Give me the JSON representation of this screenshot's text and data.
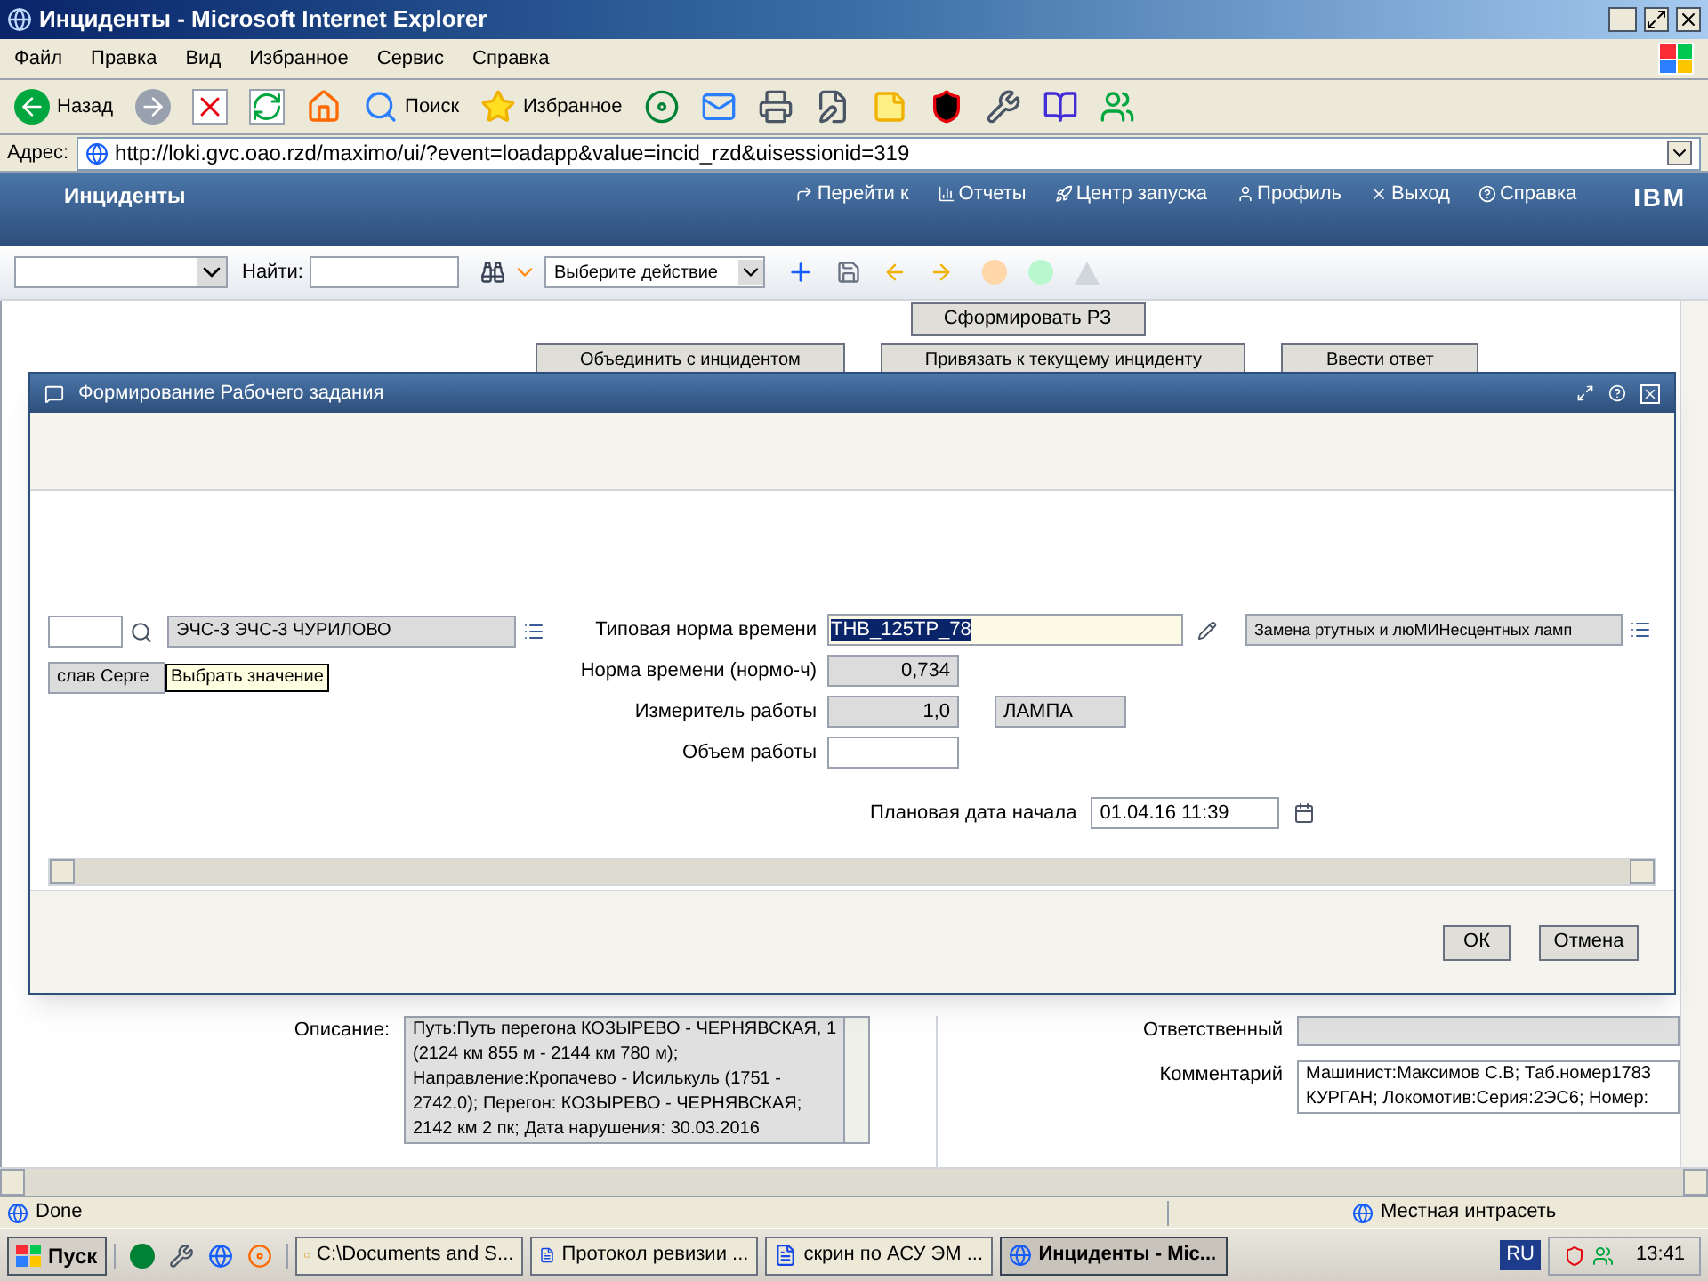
{
  "window": {
    "title": "Инциденты - Microsoft Internet Explorer"
  },
  "menu": [
    "Файл",
    "Правка",
    "Вид",
    "Избранное",
    "Сервис",
    "Справка"
  ],
  "toolbar": [
    {
      "kind": "back",
      "label": "Назад"
    },
    {
      "kind": "forward"
    },
    {
      "kind": "stop"
    },
    {
      "kind": "refresh"
    },
    {
      "kind": "home"
    },
    {
      "kind": "search",
      "label": "Поиск"
    },
    {
      "kind": "favorites",
      "label": "Избранное"
    },
    {
      "kind": "media"
    },
    {
      "kind": "mail"
    },
    {
      "kind": "print"
    },
    {
      "kind": "edit"
    },
    {
      "kind": "note"
    },
    {
      "kind": "antivirus"
    },
    {
      "kind": "tool"
    },
    {
      "kind": "research"
    },
    {
      "kind": "messenger"
    }
  ],
  "address": {
    "label": "Адрес:",
    "url": "http://loki.gvc.oao.rzd/maximo/ui/?event=loadapp&value=incid_rzd&uisessionid=319"
  },
  "app_header": {
    "title": "Инциденты",
    "logo": "IBM",
    "links": [
      {
        "kind": "goto",
        "label": "Перейти к"
      },
      {
        "kind": "reports",
        "label": "Отчеты"
      },
      {
        "kind": "launch",
        "label": "Центр запуска"
      },
      {
        "kind": "profile",
        "label": "Профиль"
      },
      {
        "kind": "logout",
        "label": "Выход"
      },
      {
        "kind": "help",
        "label": "Справка"
      }
    ]
  },
  "app_toolbar": {
    "find_label": "Найти:",
    "action": "Выберите действие"
  },
  "page": {
    "top_button": "Сформировать РЗ",
    "buttons": [
      "Объединить с инцидентом",
      "Привязать к текущему инциденту",
      "Ввести ответ"
    ],
    "description": {
      "label": "Описание:",
      "lines": [
        "Путь:Путь перегона КОЗЫРЕВО - ЧЕРНЯВСКАЯ, 1",
        "(2124 км 855 м - 2144 км 780 м);",
        "Направление:Кропачево - Исилькуль (1751 -",
        "2742.0); Перегон: КОЗЫРЕВО - ЧЕРНЯВСКАЯ;",
        "2142 км 2 пк; Дата нарушения: 30.03.2016"
      ]
    },
    "responsible": {
      "label": "Ответственный"
    },
    "comment": {
      "label": "Комментарий",
      "lines": [
        "Машинист:Максимов С.В; Таб.номер1783",
        "КУРГАН; Локомотив:Серия:2ЭС6; Номер:"
      ]
    }
  },
  "dialog": {
    "title": "Формирование Рабочего задания",
    "department": "ЭЧС-3 ЭЧС-3 ЧУРИЛОВО",
    "person": "слав Серге",
    "tooltip": "Выбрать значение",
    "norm_type": {
      "label": "Типовая норма времени",
      "value": "ТНВ_125ТР_78",
      "selected": true
    },
    "norm_name": "Замена ртутных и люМИНесцентных ламп",
    "norm_time": {
      "label": "Норма времени (нормо-ч)",
      "value": "0,734"
    },
    "meter": {
      "label": "Измеритель работы",
      "value": "1,0",
      "unit": "ЛАМПА"
    },
    "volume": {
      "label": "Объем работы"
    },
    "start_date": {
      "label": "Плановая дата начала",
      "value": "01.04.16 11:39"
    },
    "buttons": [
      "ОК",
      "Отмена"
    ]
  },
  "status_bar": {
    "text": "Done",
    "zone": "Местная интрасеть"
  },
  "taskbar": {
    "start": "Пуск",
    "lang": "RU",
    "clock": "13:41",
    "tasks": [
      {
        "kind": "folder",
        "label": "C:\\Documents and S...",
        "selected": false
      },
      {
        "kind": "word",
        "label": "Протокол ревизии ...",
        "selected": false
      },
      {
        "kind": "word",
        "label": "скрин по АСУ ЭМ ...",
        "selected": false
      },
      {
        "kind": "ie",
        "label": "Инциденты - Mic...",
        "selected": true
      }
    ]
  }
}
